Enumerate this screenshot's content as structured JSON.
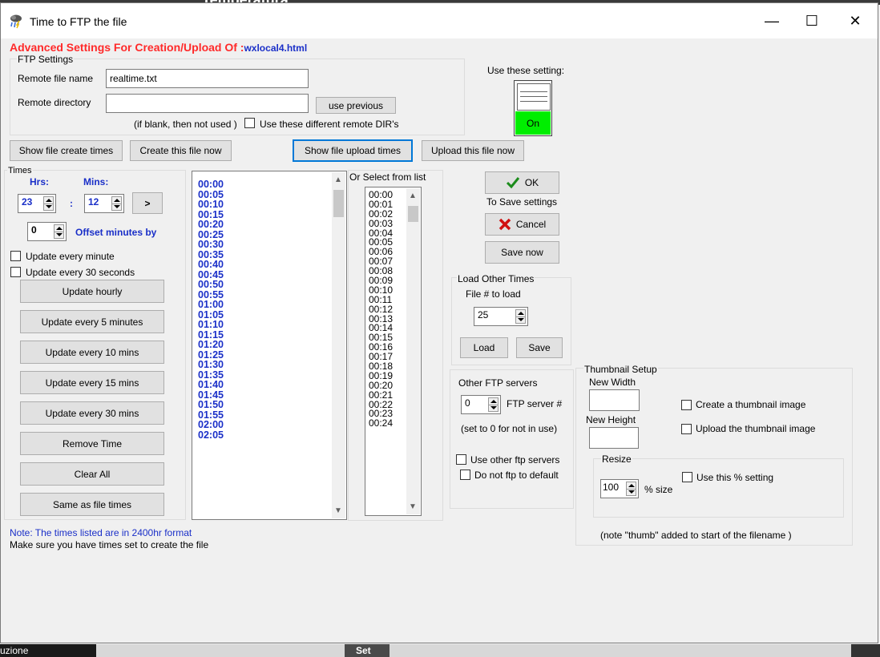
{
  "window": {
    "title": "Time to FTP the file",
    "controls": {
      "minimize": "—",
      "maximize": "☐",
      "close": "✕"
    }
  },
  "background": {
    "top_text": "Temperatura",
    "bottom_left": "uzione",
    "bottom_mid": "Set"
  },
  "header": {
    "prefix": "Advanced Settings For Creation/Upload Of :",
    "filename": "wxlocal4.html"
  },
  "ftp_settings": {
    "group_label": "FTP Settings",
    "remote_file_label": "Remote file name",
    "remote_file_value": "realtime.txt",
    "remote_dir_label": "Remote directory",
    "remote_dir_value": "",
    "use_previous": "use previous",
    "blank_note": "(if blank, then not used )",
    "different_dirs_label": "Use these different remote DIR's"
  },
  "use_setting": {
    "label": "Use these setting:",
    "state": "On"
  },
  "toolbar": {
    "show_create": "Show file create times",
    "create_now": "Create this file now",
    "show_upload": "Show file upload times",
    "upload_now": "Upload this file now"
  },
  "times": {
    "group_label": "Times",
    "hrs_label": "Hrs:",
    "mins_label": "Mins:",
    "hrs_value": "23",
    "colon": ":",
    "mins_value": "12",
    "add_button": ">",
    "offset_value": "0",
    "offset_label": "Offset minutes by",
    "every_minute": "Update every minute",
    "every_30s": "Update every 30 seconds",
    "buttons": [
      "Update hourly",
      "Update every 5 minutes",
      "Update every 10 mins",
      "Update every 15 mins",
      "Update every 30 mins",
      "Remove Time",
      "Clear All",
      "Same as file times"
    ]
  },
  "times_list": [
    "00:00",
    "00:05",
    "00:10",
    "00:15",
    "00:20",
    "00:25",
    "00:30",
    "00:35",
    "00:40",
    "00:45",
    "00:50",
    "00:55",
    "01:00",
    "01:05",
    "01:10",
    "01:15",
    "01:20",
    "01:25",
    "01:30",
    "01:35",
    "01:40",
    "01:45",
    "01:50",
    "01:55",
    "02:00",
    "02:05"
  ],
  "select_list": {
    "label": "Or Select from list",
    "items": [
      "00:00",
      "00:01",
      "00:02",
      "00:03",
      "00:04",
      "00:05",
      "00:06",
      "00:07",
      "00:08",
      "00:09",
      "00:10",
      "00:11",
      "00:12",
      "00:13",
      "00:14",
      "00:15",
      "00:16",
      "00:17",
      "00:18",
      "00:19",
      "00:20",
      "00:21",
      "00:22",
      "00:23",
      "00:24"
    ]
  },
  "actions": {
    "ok": "OK",
    "save_settings_note": "To Save settings",
    "cancel": "Cancel",
    "save_now": "Save now"
  },
  "load_other": {
    "group_label": "Load Other Times",
    "file_label": "File # to load",
    "file_value": "25",
    "load": "Load",
    "save": "Save"
  },
  "other_ftp": {
    "label": "Other FTP servers",
    "server_value": "0",
    "server_label": "FTP server #",
    "note": "(set to 0 for not in use)",
    "use_other": "Use other ftp servers",
    "no_default": "Do not ftp to default"
  },
  "thumbnail": {
    "group_label": "Thumbnail Setup",
    "new_width": "New Width",
    "new_height": "New Height",
    "create_thumb": "Create a thumbnail image",
    "upload_thumb": "Upload the thumbnail image",
    "resize_label": "Resize",
    "percent_value": "100",
    "size_label": "% size",
    "use_percent": "Use this % setting",
    "note": "(note \"thumb\" added to start of the filename )"
  },
  "footer": {
    "note1": "Note: The times listed are in 2400hr format",
    "note2": "Make sure you have times set to create the file"
  },
  "colors": {
    "accent_red": "#ff2a2a",
    "accent_blue": "#1a2fc8",
    "toggle_green": "#00ee00"
  }
}
